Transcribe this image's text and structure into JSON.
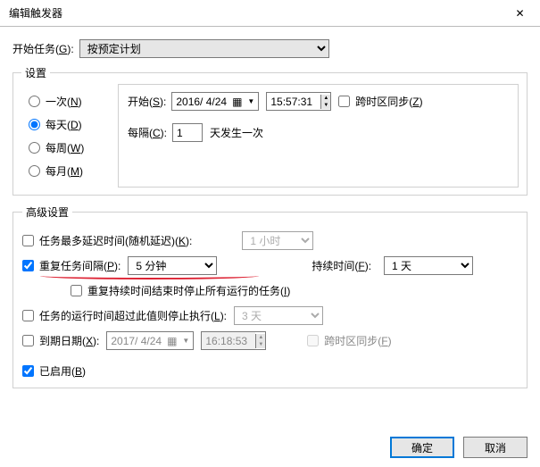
{
  "title": "编辑触发器",
  "startTaskLabel_pre": "开始任务(",
  "startTaskLabel_u": "G",
  "startTaskLabel_post": "):",
  "startTaskValue": "按预定计划",
  "settingsLegend": "设置",
  "radios": {
    "once_pre": "一次(",
    "once_u": "N",
    "once_post": ")",
    "daily_pre": "每天(",
    "daily_u": "D",
    "daily_post": ")",
    "weekly_pre": "每周(",
    "weekly_u": "W",
    "weekly_post": ")",
    "monthly_pre": "每月(",
    "monthly_u": "M",
    "monthly_post": ")"
  },
  "start": {
    "label_pre": "开始(",
    "label_u": "S",
    "label_post": "):",
    "date": "2016/ 4/24",
    "time": "15:57:31",
    "tz_pre": "跨时区同步(",
    "tz_u": "Z",
    "tz_post": ")"
  },
  "interval": {
    "label_pre": "每隔(",
    "label_u": "C",
    "label_post": "):",
    "value": "1",
    "suffix": "天发生一次"
  },
  "advLegend": "高级设置",
  "adv": {
    "delay_pre": "任务最多延迟时间(随机延迟)(",
    "delay_u": "K",
    "delay_post": "):",
    "delay_value": "1 小时",
    "repeat_pre": "重复任务间隔(",
    "repeat_u": "P",
    "repeat_post": "):",
    "repeat_value": "5 分钟",
    "duration_pre": "持续时间(",
    "duration_u": "F",
    "duration_post": "):",
    "duration_value": "1 天",
    "stopall_pre": "重复持续时间结束时停止所有运行的任务(",
    "stopall_u": "I",
    "stopall_post": ")",
    "stopafter_pre": "任务的运行时间超过此值则停止执行(",
    "stopafter_u": "L",
    "stopafter_post": "):",
    "stopafter_value": "3 天",
    "expire_pre": "到期日期(",
    "expire_u": "X",
    "expire_post": "):",
    "expire_date": "2017/ 4/24",
    "expire_time": "16:18:53",
    "expire_tz_pre": "跨时区同步(",
    "expire_tz_u": "F",
    "expire_tz_post": ")",
    "enabled_pre": "已启用(",
    "enabled_u": "B",
    "enabled_post": ")"
  },
  "buttons": {
    "ok": "确定",
    "cancel": "取消"
  }
}
